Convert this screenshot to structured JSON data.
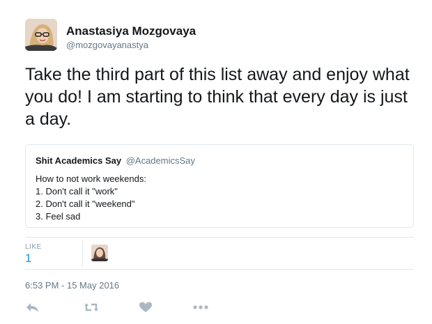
{
  "tweet": {
    "author_name": "Anastasiya Mozgovaya",
    "author_handle": "@mozgovayanastya",
    "text": "Take the third part of this list away and enjoy what you do! I am starting to think that every day is just a day."
  },
  "quoted_tweet": {
    "author_name": "Shit Academics Say",
    "author_handle": "@AcademicsSay",
    "lines": [
      "How to not work weekends:",
      "1. Don't call it \"work\"",
      "2. Don't call it \"weekend\"",
      "3. Feel sad"
    ]
  },
  "stats": {
    "like_label": "LIKE",
    "like_count": "1"
  },
  "timestamp": "6:53 PM - 15 May 2016",
  "actions": {
    "reply_icon": "reply-icon",
    "retweet_icon": "retweet-icon",
    "like_icon": "heart-icon",
    "more_icon": "more-icon"
  },
  "colors": {
    "link_blue": "#1b95e0",
    "secondary_text": "#657786",
    "action_icon": "#aab8c2",
    "border": "#e1e8ed"
  }
}
